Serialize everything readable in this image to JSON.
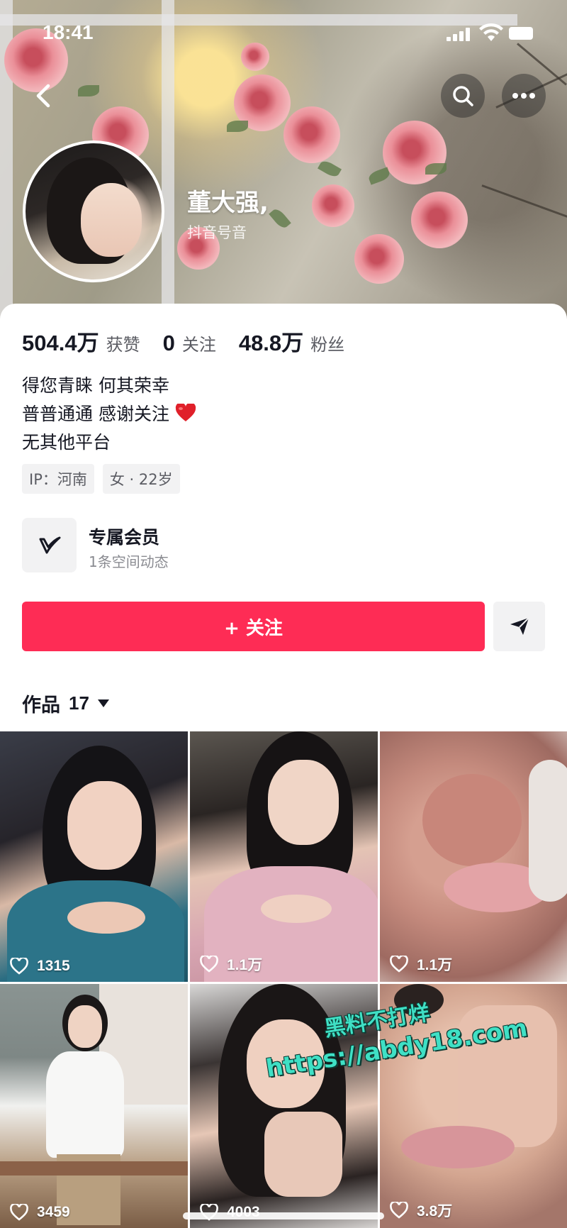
{
  "status_bar": {
    "time": "18:41"
  },
  "profile": {
    "nickname": "董大强,",
    "douyin_id": "抖音号音",
    "stats": [
      {
        "value": "504.4万",
        "label": "获赞"
      },
      {
        "value": "0",
        "label": "关注"
      },
      {
        "value": "48.8万",
        "label": "粉丝"
      }
    ],
    "bio": [
      "得您青睐 何其荣幸",
      "普普通通 感谢关注",
      "无其他平台"
    ],
    "bio_emoji": "heart-icon",
    "tags": [
      "IP：河南",
      "女 · 22岁"
    ]
  },
  "member": {
    "title": "专属会员",
    "subtitle": "1条空间动态"
  },
  "actions": {
    "follow_label": "+ 关注"
  },
  "works": {
    "label": "作品",
    "count": "17"
  },
  "grid": {
    "tiles": [
      {
        "likes": "1315"
      },
      {
        "likes": "1.1万"
      },
      {
        "likes": "1.1万"
      },
      {
        "likes": "3459"
      },
      {
        "likes": "4003"
      },
      {
        "likes": "3.8万"
      }
    ]
  },
  "watermark": {
    "line1": "黑料不打烊",
    "line2": "https://abdy18.com"
  },
  "colors": {
    "accent": "#fe2c55",
    "watermark": "#3fe0c5",
    "text": "#161823",
    "muted": "#5b5c63"
  }
}
